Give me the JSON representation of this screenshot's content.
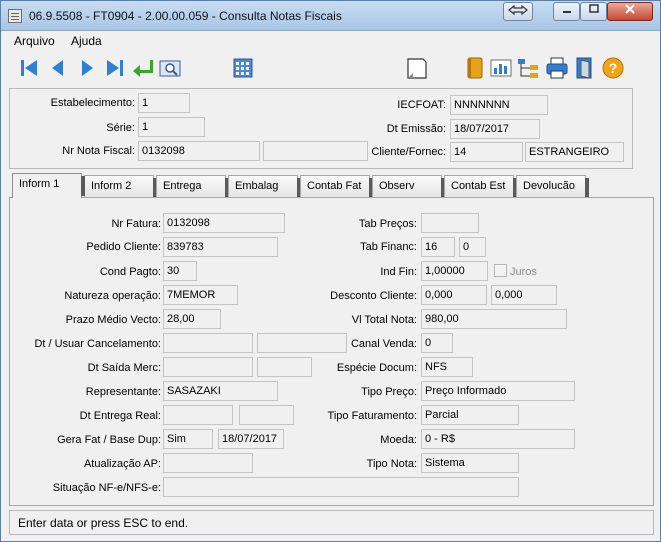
{
  "window": {
    "title": "06.9.5508 - FT0904 - 2.00.00.059 - Consulta Notas Fiscais"
  },
  "menu": {
    "arquivo": "Arquivo",
    "ajuda": "Ajuda"
  },
  "toolbar": {
    "icons": [
      "first-record-icon",
      "previous-record-icon",
      "next-record-icon",
      "last-record-icon",
      "return-icon",
      "zoom-icon",
      "calendar-icon",
      "blank-document-icon",
      "notebook-icon",
      "chart-icon",
      "tree-icon",
      "print-icon",
      "exit-icon",
      "help-icon"
    ]
  },
  "header": {
    "estabelecimento": {
      "label": "Estabelecimento:",
      "value": "1"
    },
    "serie": {
      "label": "Série:",
      "value": "1"
    },
    "nr_nota_fiscal": {
      "label": "Nr Nota Fiscal:",
      "value": "0132098",
      "value2": ""
    },
    "iecfoat": {
      "label": "IECFOAT:",
      "value": "NNNNNNN"
    },
    "dt_emissao": {
      "label": "Dt Emissão:",
      "value": "18/07/2017"
    },
    "cliente_fornec": {
      "label": "Cliente/Fornec:",
      "code": "14",
      "name": "ESTRANGEIRO"
    }
  },
  "tabs": [
    {
      "label": "Inform 1",
      "active": true
    },
    {
      "label": "Inform 2",
      "active": false
    },
    {
      "label": "Entrega",
      "active": false
    },
    {
      "label": "Embalag",
      "active": false
    },
    {
      "label": "Contab Fat",
      "active": false
    },
    {
      "label": "Observ",
      "active": false
    },
    {
      "label": "Contab Est",
      "active": false
    },
    {
      "label": "Devolucão",
      "active": false
    }
  ],
  "form": {
    "nr_fatura": {
      "label": "Nr Fatura:",
      "value": "0132098"
    },
    "pedido_cliente": {
      "label": "Pedido Cliente:",
      "value": "839783"
    },
    "cond_pagto": {
      "label": "Cond Pagto:",
      "value": "30"
    },
    "natureza_operacao": {
      "label": "Natureza operação:",
      "value": "7MEMOR"
    },
    "prazo_medio_vecto": {
      "label": "Prazo Médio Vecto:",
      "value": "28,00"
    },
    "dt_usuar_cancelamento": {
      "label": "Dt / Usuar Cancelamento:",
      "value1": "",
      "value2": ""
    },
    "dt_saida_merc": {
      "label": "Dt Saída Merc:",
      "value1": "",
      "value2": ""
    },
    "representante": {
      "label": "Representante:",
      "value": "SASAZAKI"
    },
    "dt_entrega_real": {
      "label": "Dt Entrega Real:",
      "value1": "",
      "value2": ""
    },
    "gera_fat_base_dup": {
      "label": "Gera Fat / Base Dup:",
      "value1": "Sim",
      "value2": "18/07/2017"
    },
    "atualizacao_ap": {
      "label": "Atualização AP:",
      "value": ""
    },
    "situacao_nfe": {
      "label": "Situação NF-e/NFS-e:",
      "value": ""
    },
    "tab_precos": {
      "label": "Tab Preços:",
      "value": ""
    },
    "tab_financ": {
      "label": "Tab Financ:",
      "value1": "16",
      "value2": "0"
    },
    "ind_fin": {
      "label": "Ind Fin:",
      "value": "1,00000",
      "checkbox_label": "Juros",
      "checked": false
    },
    "desconto_cliente": {
      "label": "Desconto Cliente:",
      "value1": "0,000",
      "value2": "0,000"
    },
    "vl_total_nota": {
      "label": "Vl Total Nota:",
      "value": "980,00"
    },
    "canal_venda": {
      "label": "Canal Venda:",
      "value": "0"
    },
    "especie_docum": {
      "label": "Espécie Docum:",
      "value": "NFS"
    },
    "tipo_preco": {
      "label": "Tipo Preço:",
      "value": "Preço Informado"
    },
    "tipo_faturamento": {
      "label": "Tipo Faturamento:",
      "value": "Parcial"
    },
    "moeda": {
      "label": "Moeda:",
      "value": "0 - R$"
    },
    "tipo_nota": {
      "label": "Tipo Nota:",
      "value": "Sistema"
    }
  },
  "status": {
    "message": "Enter data or press ESC to end."
  }
}
